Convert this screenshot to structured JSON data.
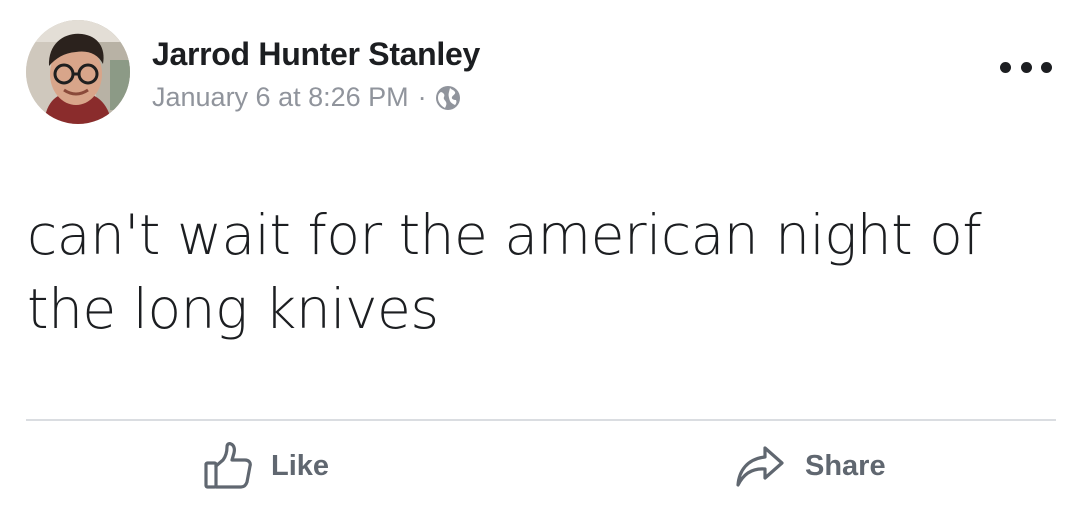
{
  "post": {
    "author": "Jarrod Hunter Stanley",
    "timestamp": "January 6 at 8:26 PM",
    "separator": "·",
    "audience_icon": "globe-icon",
    "text": "can't wait for the american night of the long knives",
    "more_icon": "more-options-icon"
  },
  "actions": {
    "like_label": "Like",
    "like_icon": "thumbs-up-icon",
    "share_label": "Share",
    "share_icon": "share-arrow-icon"
  },
  "colors": {
    "text": "#1c1e21",
    "meta": "#90949c",
    "action": "#606770",
    "divider": "#dadde1",
    "background": "#ffffff"
  }
}
